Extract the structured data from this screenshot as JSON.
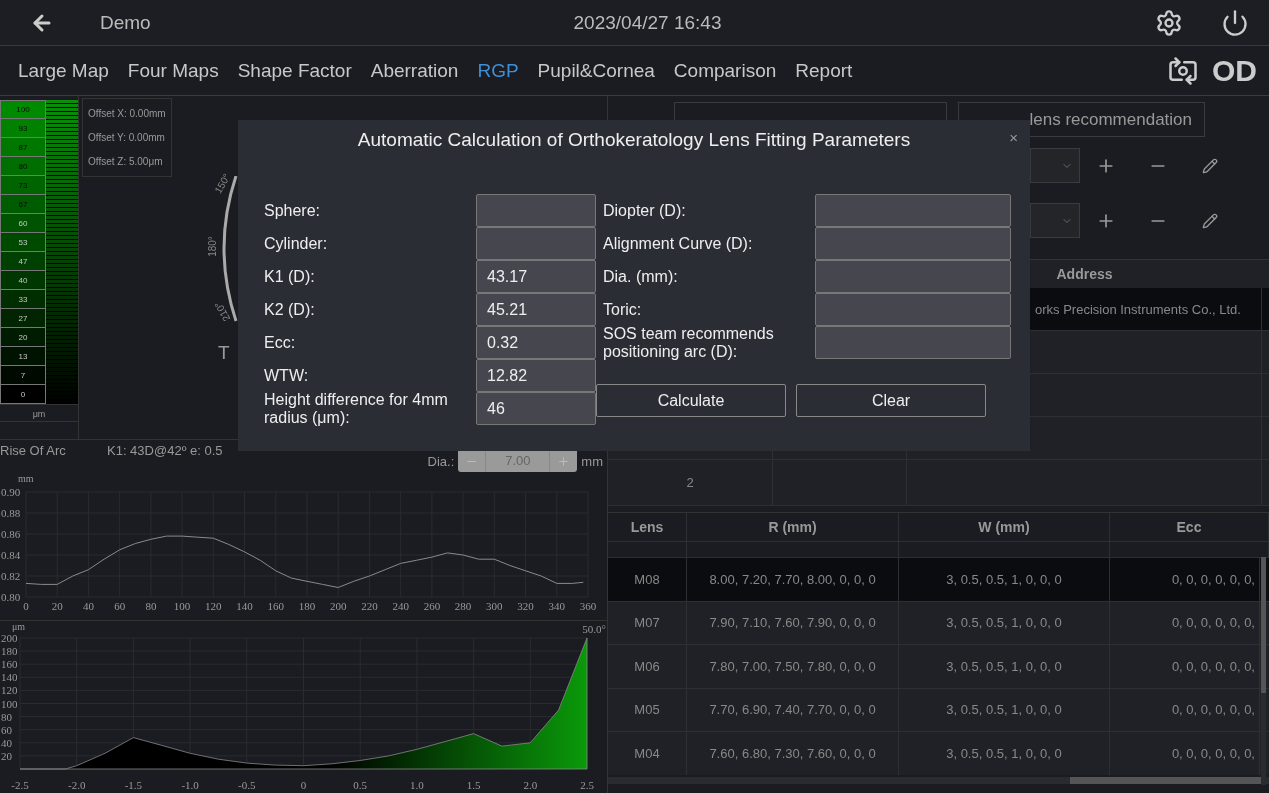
{
  "header": {
    "title": "Demo",
    "datetime": "2023/04/27 16:43"
  },
  "nav": {
    "tabs": [
      {
        "label": "Large Map",
        "selected": false
      },
      {
        "label": "Four Maps",
        "selected": false
      },
      {
        "label": "Shape Factor",
        "selected": false
      },
      {
        "label": "Aberration",
        "selected": false
      },
      {
        "label": "RGP",
        "selected": true
      },
      {
        "label": "Pupil&Cornea",
        "selected": false
      },
      {
        "label": "Comparison",
        "selected": false
      },
      {
        "label": "Report",
        "selected": false
      }
    ],
    "eye": "OD"
  },
  "scale": {
    "steps": [
      "100",
      "93",
      "87",
      "80",
      "73",
      "67",
      "60",
      "53",
      "47",
      "40",
      "33",
      "27",
      "20",
      "13",
      "7",
      "0"
    ],
    "unit": "μm"
  },
  "offsets": [
    "Offset X: 0.00mm",
    "Offset Y: 0.00mm",
    "Offset Z: 5.00μm"
  ],
  "map": {
    "angle_labels": [
      "150°",
      "180°",
      "210°"
    ],
    "side_label": "T"
  },
  "rise_of_arc": {
    "title": "Rise Of Arc",
    "k1": "K1: 43D@42º e: 0.5",
    "dia": {
      "label": "Dia.:",
      "value": "7.00",
      "unit": "mm"
    },
    "chart_data": {
      "type": "line",
      "grid": true,
      "ylabel": "mm",
      "x": [
        0,
        10,
        20,
        30,
        40,
        50,
        60,
        70,
        80,
        90,
        100,
        110,
        120,
        130,
        140,
        150,
        160,
        170,
        180,
        190,
        200,
        210,
        220,
        230,
        240,
        250,
        260,
        270,
        280,
        290,
        300,
        310,
        320,
        330,
        340,
        350,
        357
      ],
      "values": [
        0.813,
        0.812,
        0.812,
        0.82,
        0.826,
        0.836,
        0.845,
        0.851,
        0.855,
        0.858,
        0.858,
        0.857,
        0.856,
        0.85,
        0.843,
        0.835,
        0.825,
        0.818,
        0.815,
        0.812,
        0.809,
        0.815,
        0.82,
        0.826,
        0.832,
        0.835,
        0.838,
        0.842,
        0.84,
        0.836,
        0.836,
        0.83,
        0.825,
        0.82,
        0.813,
        0.813,
        0.814
      ],
      "xlim": [
        0,
        360
      ],
      "ylim": [
        0.8,
        0.9
      ],
      "xticks": [
        0,
        20,
        40,
        60,
        80,
        100,
        120,
        140,
        160,
        180,
        200,
        220,
        240,
        260,
        280,
        300,
        320,
        340,
        360
      ],
      "yticks": [
        {
          "value": 0.8,
          "label": "0.80"
        },
        {
          "value": 0.82,
          "label": "0.82"
        },
        {
          "value": 0.84,
          "label": "0.84"
        },
        {
          "value": 0.86,
          "label": "0.86"
        },
        {
          "value": 0.88,
          "label": "0.88"
        },
        {
          "value": 0.9,
          "label": "0.90"
        }
      ]
    }
  },
  "height_profile": {
    "angle": "50.0°",
    "chart_data": {
      "type": "area",
      "grid": true,
      "ylabel": "μm",
      "x": [
        -2.5,
        -2.25,
        -2.1,
        -2.0,
        -1.75,
        -1.5,
        -1.25,
        -1.0,
        -0.75,
        -0.5,
        -0.25,
        0,
        0.25,
        0.5,
        0.75,
        1.0,
        1.25,
        1.5,
        1.75,
        2.0,
        2.25,
        2.5
      ],
      "values": [
        0,
        0,
        0,
        5,
        24,
        48,
        36,
        24,
        15,
        9,
        6,
        5,
        8,
        13,
        20,
        30,
        42,
        54,
        35,
        40,
        90,
        200
      ],
      "xlim": [
        -2.5,
        2.5
      ],
      "ylim": [
        0,
        200
      ],
      "xticks": [
        {
          "value": -2.5,
          "label": "-2.5"
        },
        {
          "value": -2,
          "label": "-2.0"
        },
        {
          "value": -1.5,
          "label": "-1.5"
        },
        {
          "value": -1,
          "label": "-1.0"
        },
        {
          "value": -0.5,
          "label": "-0.5"
        },
        {
          "value": 0,
          "label": "0"
        },
        {
          "value": 0.5,
          "label": "0.5"
        },
        {
          "value": 1,
          "label": "1.0"
        },
        {
          "value": 1.5,
          "label": "1.5"
        },
        {
          "value": 2,
          "label": "2.0"
        },
        {
          "value": 2.5,
          "label": "2.5"
        }
      ],
      "yticks": [
        20,
        40,
        60,
        80,
        100,
        120,
        140,
        160,
        180,
        200
      ]
    }
  },
  "recommendation_tab": {
    "label": "lens recommendation"
  },
  "company_table": {
    "columns": [
      "Address"
    ],
    "rows": [
      {
        "address": "orks Precision Instruments Co., Ltd.",
        "selected": true
      },
      {
        "selected": false
      },
      {
        "selected": false
      },
      {
        "selected": false
      },
      {
        "number": "2",
        "selected": false
      }
    ]
  },
  "lens_table": {
    "columns": [
      "Lens",
      "R (mm)",
      "W (mm)",
      "Ecc"
    ],
    "rows": [
      {
        "lens": "M08",
        "r": "8.00, 7.20, 7.70, 8.00, 0, 0, 0",
        "w": "3, 0.5, 0.5, 1, 0, 0, 0",
        "ecc": "0, 0, 0, 0, 0, 0,",
        "selected": true
      },
      {
        "lens": "M07",
        "r": "7.90, 7.10, 7.60, 7.90, 0, 0, 0",
        "w": "3, 0.5, 0.5, 1, 0, 0, 0",
        "ecc": "0, 0, 0, 0, 0, 0,",
        "selected": false
      },
      {
        "lens": "M06",
        "r": "7.80, 7.00, 7.50, 7.80, 0, 0, 0",
        "w": "3, 0.5, 0.5, 1, 0, 0, 0",
        "ecc": "0, 0, 0, 0, 0, 0,",
        "selected": false
      },
      {
        "lens": "M05",
        "r": "7.70, 6.90, 7.40, 7.70, 0, 0, 0",
        "w": "3, 0.5, 0.5, 1, 0, 0, 0",
        "ecc": "0, 0, 0, 0, 0, 0,",
        "selected": false
      },
      {
        "lens": "M04",
        "r": "7.60, 6.80, 7.30, 7.60, 0, 0, 0",
        "w": "3, 0.5, 0.5, 1, 0, 0, 0",
        "ecc": "0, 0, 0, 0, 0, 0,",
        "selected": false
      }
    ]
  },
  "dialog": {
    "title": "Automatic Calculation of Orthokeratology Lens Fitting Parameters",
    "close": "×",
    "left_fields": [
      {
        "label": "Sphere:"
      },
      {
        "label": "Cylinder:"
      },
      {
        "label": "K1 (D):",
        "value": "43.17"
      },
      {
        "label": "K2 (D):",
        "value": "45.21"
      },
      {
        "label": "Ecc:",
        "value": "0.32"
      },
      {
        "label": "WTW:",
        "value": "12.82"
      },
      {
        "label": "Height difference for 4mm radius (μm):",
        "value": "46"
      }
    ],
    "right_fields": [
      {
        "label": "Diopter (D):"
      },
      {
        "label": "Alignment Curve (D):"
      },
      {
        "label": "Dia. (mm):"
      },
      {
        "label": "Toric:"
      },
      {
        "label": "SOS team recommends positioning arc (D):"
      }
    ],
    "buttons": [
      "Calculate",
      "Clear"
    ]
  }
}
